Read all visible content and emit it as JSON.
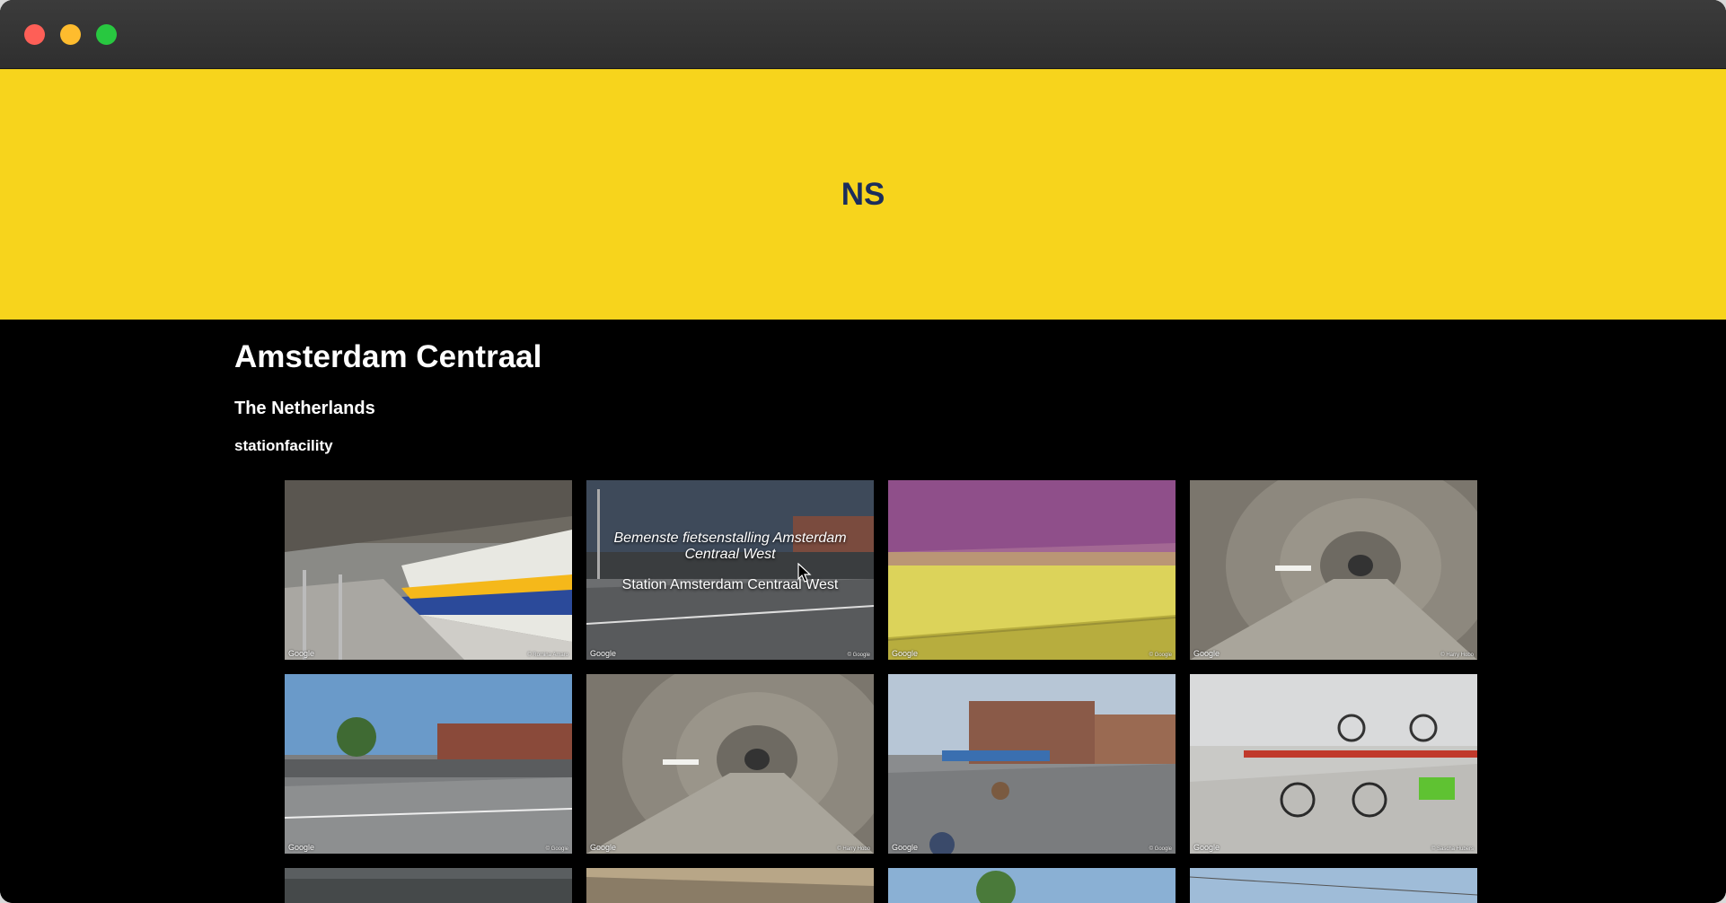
{
  "banner": {
    "logo_text": "NS",
    "color": "#f7d41c"
  },
  "station": {
    "name": "Amsterdam Centraal",
    "country": "The Netherlands",
    "category": "stationfacility"
  },
  "gallery": {
    "row1": [
      {
        "google": "Google",
        "credit": "© Romina Amaro"
      },
      {
        "google": "Google",
        "credit": "© Google",
        "overlay_title": "Bemenste fietsenstalling Amsterdam Centraal West",
        "overlay_sub": "Station Amsterdam Centraal West"
      },
      {
        "google": "Google",
        "credit": "© Google"
      },
      {
        "google": "Google",
        "credit": "© Harry Hobo"
      }
    ],
    "row2": [
      {
        "google": "Google",
        "credit": "© Google"
      },
      {
        "google": "Google",
        "credit": "© Harry Hobo"
      },
      {
        "google": "Google",
        "credit": "© Google"
      },
      {
        "google": "Google",
        "credit": "© Sascha Hubers"
      }
    ]
  }
}
